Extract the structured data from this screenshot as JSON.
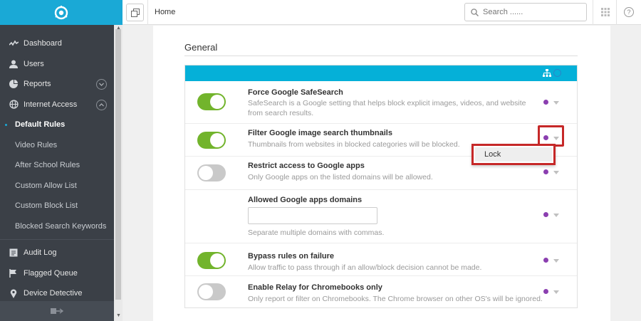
{
  "sidebar": {
    "items": [
      {
        "label": "Dashboard",
        "icon": "activity-icon"
      },
      {
        "label": "Users",
        "icon": "user-icon"
      },
      {
        "label": "Reports",
        "icon": "pie-chart-icon"
      },
      {
        "label": "Internet Access",
        "icon": "globe-icon"
      }
    ],
    "sub_items": [
      {
        "label": "Default Rules",
        "active": true
      },
      {
        "label": "Video Rules"
      },
      {
        "label": "After School Rules"
      },
      {
        "label": "Custom Allow List"
      },
      {
        "label": "Custom Block List"
      },
      {
        "label": "Blocked Search Keywords"
      }
    ],
    "bottom_items": [
      {
        "label": "Audit Log",
        "icon": "log-icon"
      },
      {
        "label": "Flagged Queue",
        "icon": "flag-icon"
      },
      {
        "label": "Device Detective",
        "icon": "location-pin-icon"
      }
    ]
  },
  "header": {
    "title": "Home",
    "search_placeholder": "Search ......"
  },
  "section": {
    "title": "General"
  },
  "rows": [
    {
      "title": "Force Google SafeSearch",
      "desc": "SafeSearch is a Google setting that helps block explicit images, videos, and website from search results.",
      "toggle": "on"
    },
    {
      "title": "Filter Google image search thumbnails",
      "desc": "Thumbnails from websites in blocked categories will be blocked.",
      "toggle": "on"
    },
    {
      "title": "Restrict access to Google apps",
      "desc": "Only Google apps on the listed domains will be allowed.",
      "toggle": "off"
    },
    {
      "title": "Allowed Google apps domains",
      "desc": "Separate multiple domains with commas.",
      "input_value": ""
    },
    {
      "title": "Bypass rules on failure",
      "desc": "Allow traffic to pass through if an allow/block decision cannot be made.",
      "toggle": "on"
    },
    {
      "title": "Enable Relay for Chromebooks only",
      "desc": "Only report or filter on Chromebooks. The Chrome browser on other OS's will be ignored.",
      "toggle": "off"
    }
  ],
  "lock_menu": {
    "item": "Lock"
  },
  "colors": {
    "brand": "#1aa9d6",
    "panel_header": "#05b0d8",
    "toggle_on": "#72b42c",
    "toggle_off": "#c9c9c9",
    "lock_dot": "#8b3fb0",
    "highlight": "#c62828",
    "sidebar_bg": "#3b4047"
  }
}
